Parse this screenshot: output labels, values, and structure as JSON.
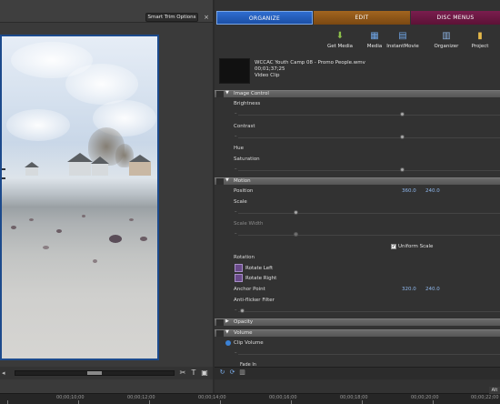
{
  "monitor": {
    "smart_trim_label": "Smart Trim Options",
    "close_glyph": "×"
  },
  "tabs": [
    {
      "label": "ORGANIZE",
      "color": "#2a63c2",
      "active": true
    },
    {
      "label": "EDIT",
      "color": "#8e5819",
      "active": false
    },
    {
      "label": "DISC MENUS",
      "color": "#6e1a45",
      "active": false
    }
  ],
  "toolbar": [
    {
      "label": "Get Media",
      "icon": "get-media-icon"
    },
    {
      "label": "Media",
      "icon": "media-icon"
    },
    {
      "label": "InstantMovie",
      "icon": "instantmovie-icon"
    },
    {
      "label": "Organizer",
      "icon": "organizer-icon"
    },
    {
      "label": "Project",
      "icon": "project-icon"
    }
  ],
  "clip": {
    "name": "WCCAC Youth Camp 08 - Promo People.wmv",
    "duration": "00;01;37;25",
    "type": "Video Clip"
  },
  "sections": {
    "image_control": "Image Control",
    "motion": "Motion",
    "opacity": "Opacity",
    "volume": "Volume"
  },
  "image_control": {
    "brightness": "Brightness",
    "contrast": "Contrast",
    "hue": "Hue",
    "saturation": "Saturation"
  },
  "motion": {
    "position_label": "Position",
    "position_x": "360.0",
    "position_y": "240.0",
    "scale_label": "Scale",
    "scale_width_label": "Scale Width",
    "uniform_scale_label": "Uniform Scale",
    "uniform_scale_checked": true,
    "rotation_label": "Rotation",
    "rotate_left_label": "Rotate Left",
    "rotate_right_label": "Rotate Right",
    "anchor_label": "Anchor Point",
    "anchor_x": "320.0",
    "anchor_y": "240.0",
    "antiflicker_label": "Anti-flicker Filter"
  },
  "volume": {
    "clip_volume_label": "Clip Volume",
    "fade_in_label": "Fade In"
  },
  "ruler": {
    "labels": [
      "00;00;10;00",
      "00;00;12;00",
      "00;00;14;00",
      "00;00;16;00",
      "00;00;18;00",
      "00;00;20;00",
      "00;00;22;00"
    ],
    "alt_label": "Alt"
  },
  "colors": {
    "panel_bg": "#323232",
    "section_header": "#5e5e5e",
    "value_blue": "#8fb8ee",
    "frame_border": "#1c4a8c"
  }
}
